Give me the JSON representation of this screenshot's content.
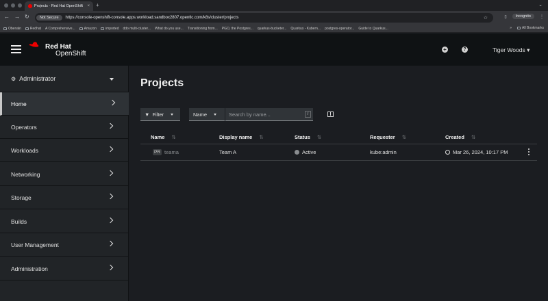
{
  "browser": {
    "tab_title": "Projects · Red Hat OpenShift",
    "new_tab": "+",
    "not_secure": "Not Secure",
    "url": "https://console-openshift-console.apps.workload.sandbox2807.opentlc.com/k8s/cluster/projects",
    "incognito": "Incognito",
    "bookmarks": [
      "Obenaln",
      "Redhat",
      "A Comprehensive...",
      "Amazon",
      "imported",
      "ddo multi-cluster...",
      "What do you use...",
      "Transitioning from...",
      "PGO, the Postgres...",
      "quarkus-bucketer...",
      "Quarkus - Kubern...",
      "postgres-operator...",
      "Guide to Quarkus..."
    ],
    "all_bookmarks": "All Bookmarks"
  },
  "masthead": {
    "brand_line1": "Red Hat",
    "brand_line2": "OpenShift",
    "plus": "+",
    "help": "?",
    "user": "Tiger Woods"
  },
  "sidebar": {
    "perspective": "Administrator",
    "items": [
      "Home",
      "Operators",
      "Workloads",
      "Networking",
      "Storage",
      "Builds",
      "User Management",
      "Administration"
    ],
    "active": "Home"
  },
  "main": {
    "title": "Projects",
    "filter_label": "Filter",
    "name_select": "Name",
    "search_placeholder": "Search by name...",
    "search_shortcut": "/",
    "columns": [
      "Name",
      "Display name",
      "Status",
      "Requester",
      "Created"
    ],
    "rows": [
      {
        "badge": "PR",
        "name": "teama",
        "display_name": "Team A",
        "status": "Active",
        "requester": "kube:admin",
        "created": "Mar 26, 2024, 10:17 PM"
      }
    ]
  },
  "colors": {
    "brand_red": "#ee0000",
    "masthead_bg": "#0f1214",
    "sidebar_bg": "#212427",
    "main_bg": "#1b1d21"
  }
}
